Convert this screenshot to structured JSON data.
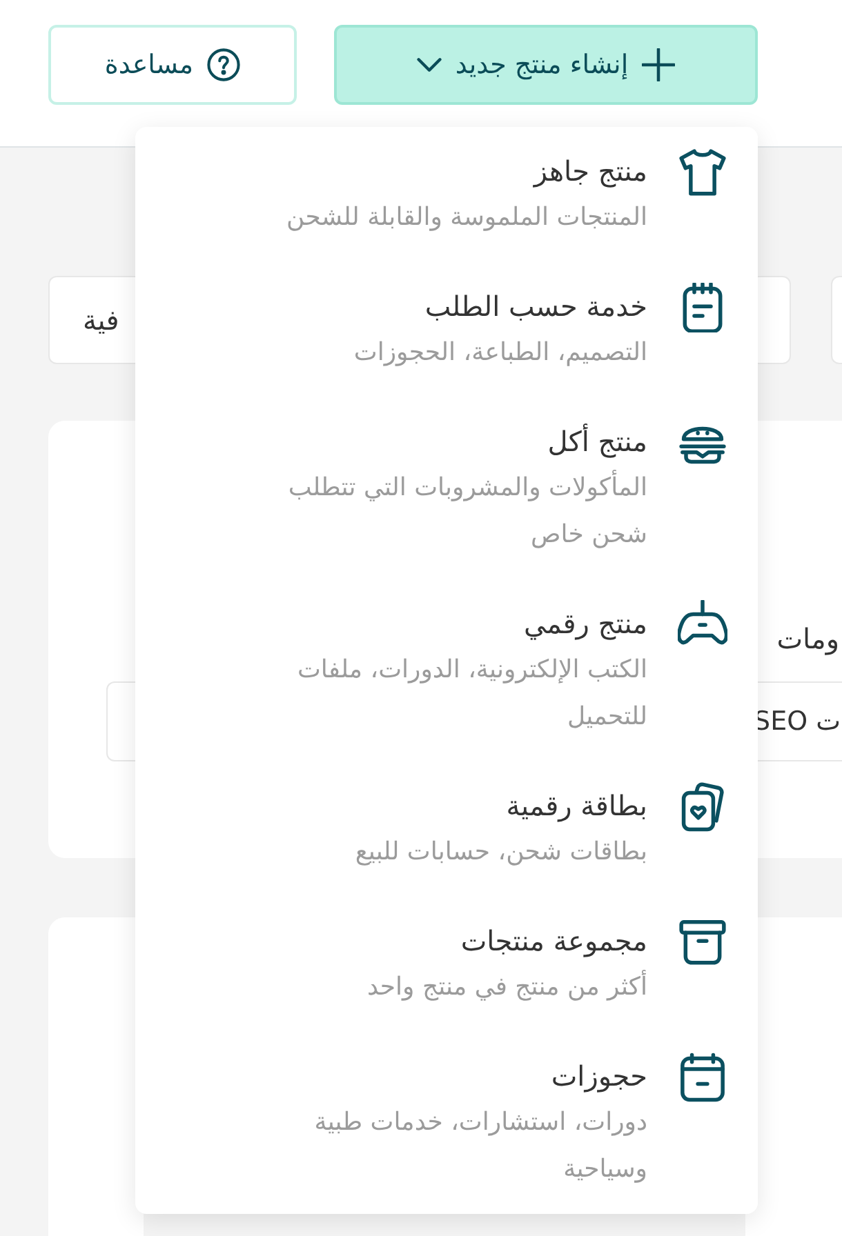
{
  "toolbar": {
    "help_button": {
      "label": "مساعدة"
    },
    "create_button": {
      "label": "إنشاء منتج جديد",
      "expanded": true
    }
  },
  "create_menu": {
    "items": [
      {
        "kind": "shirt",
        "title": "منتج جاهز",
        "description": "المنتجات الملموسة والقابلة للشحن"
      },
      {
        "kind": "notepad",
        "title": "خدمة حسب الطلب",
        "description": "التصميم، الطباعة، الحجوزات"
      },
      {
        "kind": "burger",
        "title": "منتج أكل",
        "description": "المأكولات والمشروبات التي تتطلب شحن خاص"
      },
      {
        "kind": "gamepad",
        "title": "منتج رقمي",
        "description": "الكتب الإلكترونية، الدورات، ملفات للتحميل"
      },
      {
        "kind": "cards",
        "title": "بطاقة رقمية",
        "description": "بطاقات شحن، حسابات للبيع"
      },
      {
        "kind": "box",
        "title": "مجموعة منتجات",
        "description": "أكثر من منتج في منتج واحد"
      },
      {
        "kind": "calendar",
        "title": "حجوزات",
        "description": "دورات، استشارات، خدمات طبية وسياحية"
      }
    ]
  },
  "filters": {
    "field_1": {
      "value": "فية"
    }
  },
  "section": {
    "heading": "ومات",
    "field": {
      "value": "ت SEO"
    }
  }
}
